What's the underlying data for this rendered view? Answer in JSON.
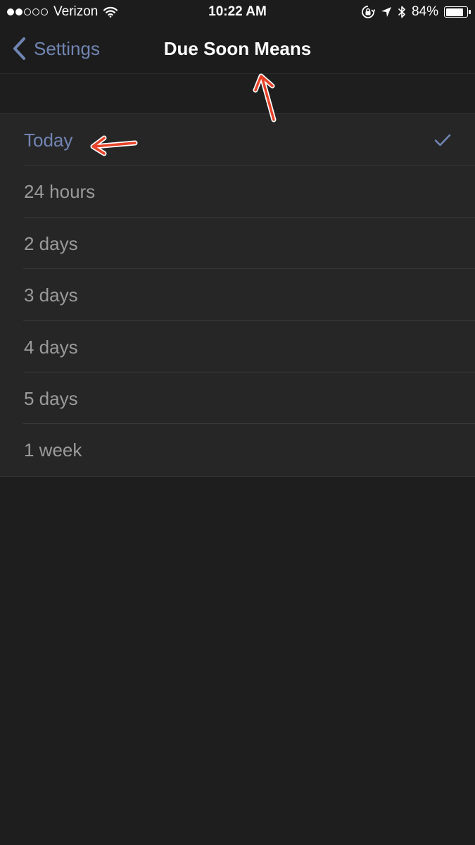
{
  "status_bar": {
    "signal_filled": 2,
    "signal_empty": 3,
    "carrier": "Verizon",
    "time": "10:22 AM",
    "battery_percent": "84%",
    "battery_level": 0.84,
    "icons": [
      "wifi-icon",
      "rotation-lock-icon",
      "location-icon",
      "bluetooth-icon",
      "battery-icon"
    ]
  },
  "nav": {
    "back_label": "Settings",
    "title": "Due Soon Means"
  },
  "options": [
    {
      "label": "Today",
      "selected": true
    },
    {
      "label": "24 hours",
      "selected": false
    },
    {
      "label": "2 days",
      "selected": false
    },
    {
      "label": "3 days",
      "selected": false
    },
    {
      "label": "4 days",
      "selected": false
    },
    {
      "label": "5 days",
      "selected": false
    },
    {
      "label": "1 week",
      "selected": false
    }
  ],
  "colors": {
    "accent": "#7185b3",
    "background": "#1e1e1e",
    "list_background": "#262626",
    "row_text": "#9a9a9a",
    "annotation_arrow": "#e8432a"
  }
}
